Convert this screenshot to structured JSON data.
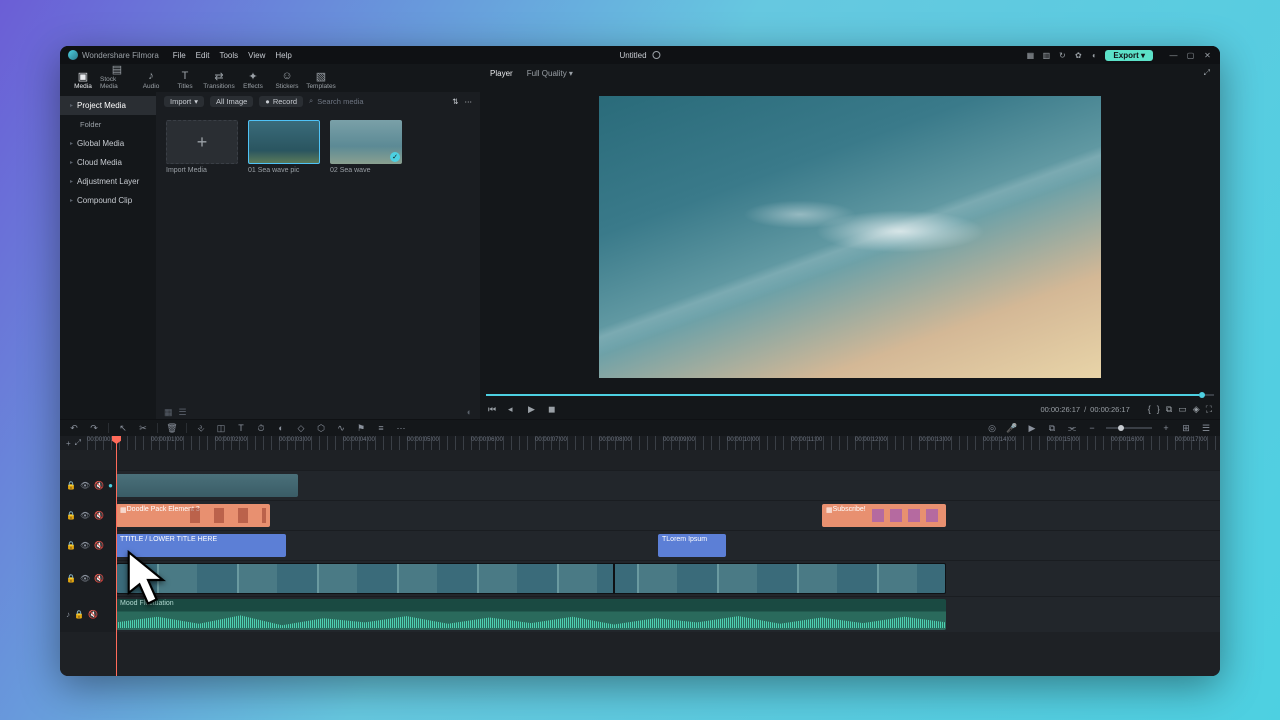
{
  "titlebar": {
    "app_name": "Wondershare Filmora",
    "menus": [
      "File",
      "Edit",
      "Tools",
      "View",
      "Help"
    ],
    "document": "Untitled",
    "export_label": "Export"
  },
  "tabs": [
    {
      "label": "Media",
      "icon": "▣"
    },
    {
      "label": "Stock Media",
      "icon": "▤"
    },
    {
      "label": "Audio",
      "icon": "♪"
    },
    {
      "label": "Titles",
      "icon": "T"
    },
    {
      "label": "Transitions",
      "icon": "⇄"
    },
    {
      "label": "Effects",
      "icon": "✦"
    },
    {
      "label": "Stickers",
      "icon": "☺"
    },
    {
      "label": "Templates",
      "icon": "▧"
    }
  ],
  "sidebar": {
    "items": [
      {
        "label": "Project Media",
        "active": true
      },
      {
        "label": "Folder",
        "sub": true
      },
      {
        "label": "Global Media"
      },
      {
        "label": "Cloud Media"
      },
      {
        "label": "Adjustment Layer"
      },
      {
        "label": "Compound Clip"
      }
    ]
  },
  "media_toolbar": {
    "import_label": "Import",
    "filter_label": "All Image",
    "record_label": "Record",
    "search_placeholder": "Search media"
  },
  "media_tiles": [
    {
      "label": "Import Media",
      "kind": "add"
    },
    {
      "label": "01 Sea wave pic",
      "kind": "sea1"
    },
    {
      "label": "02 Sea wave",
      "kind": "sea2",
      "checked": true
    }
  ],
  "preview": {
    "tab_player": "Player",
    "tab_quality": "Full Quality",
    "time_current": "00:00:26:17",
    "time_total": "00:00:26:17"
  },
  "ruler_marks": [
    "00:00:00:00",
    "00:00:01:00",
    "00:00:02:00",
    "00:00:03:00",
    "00:00:04:00",
    "00:00:05:00",
    "00:00:06:00",
    "00:00:07:00",
    "00:00:08:00",
    "00:00:09:00",
    "00:00:10:00",
    "00:00:11:00",
    "00:00:12:00",
    "00:00:13:00",
    "00:00:14:00",
    "00:00:15:00",
    "00:00:16:00",
    "00:00:17:00"
  ],
  "clips": {
    "doodle_label": "Doodle Pack Element 3",
    "subscribe_label": "Subscribe!",
    "title1_label": "TITLE / LOWER TITLE HERE",
    "title2_label": "Lorem Ipsum",
    "audio_label": "Mood Fluctuation"
  }
}
